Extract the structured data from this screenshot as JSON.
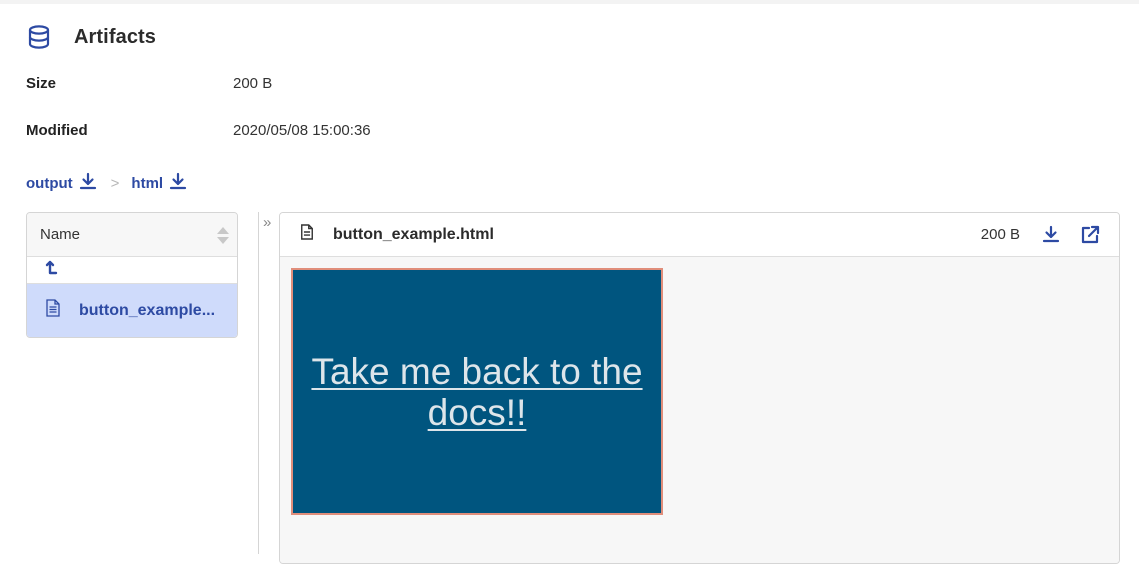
{
  "header": {
    "title": "Artifacts",
    "icon": "database-icon",
    "accent_color": "#2d4aa3"
  },
  "meta": [
    {
      "label": "Size",
      "value": "200 B"
    },
    {
      "label": "Modified",
      "value": "2020/05/08 15:00:36"
    }
  ],
  "breadcrumb": {
    "items": [
      {
        "label": "output",
        "icon": "download-icon"
      },
      {
        "label": "html",
        "icon": "download-icon"
      }
    ],
    "separator": ">"
  },
  "file_list": {
    "column_header": "Name",
    "up_symbol": "↰",
    "files": [
      {
        "name": "button_example...",
        "icon": "file-icon",
        "selected": true
      }
    ]
  },
  "viewer": {
    "collapse_symbol": "»",
    "file_name": "button_example.html",
    "file_size": "200 B",
    "actions": [
      "download-icon",
      "open-external-icon"
    ],
    "preview": {
      "link_text": "Take me back to the docs!!",
      "background_color": "#00557f",
      "border_color": "#e08e7b",
      "text_color": "#dde5ea"
    }
  }
}
